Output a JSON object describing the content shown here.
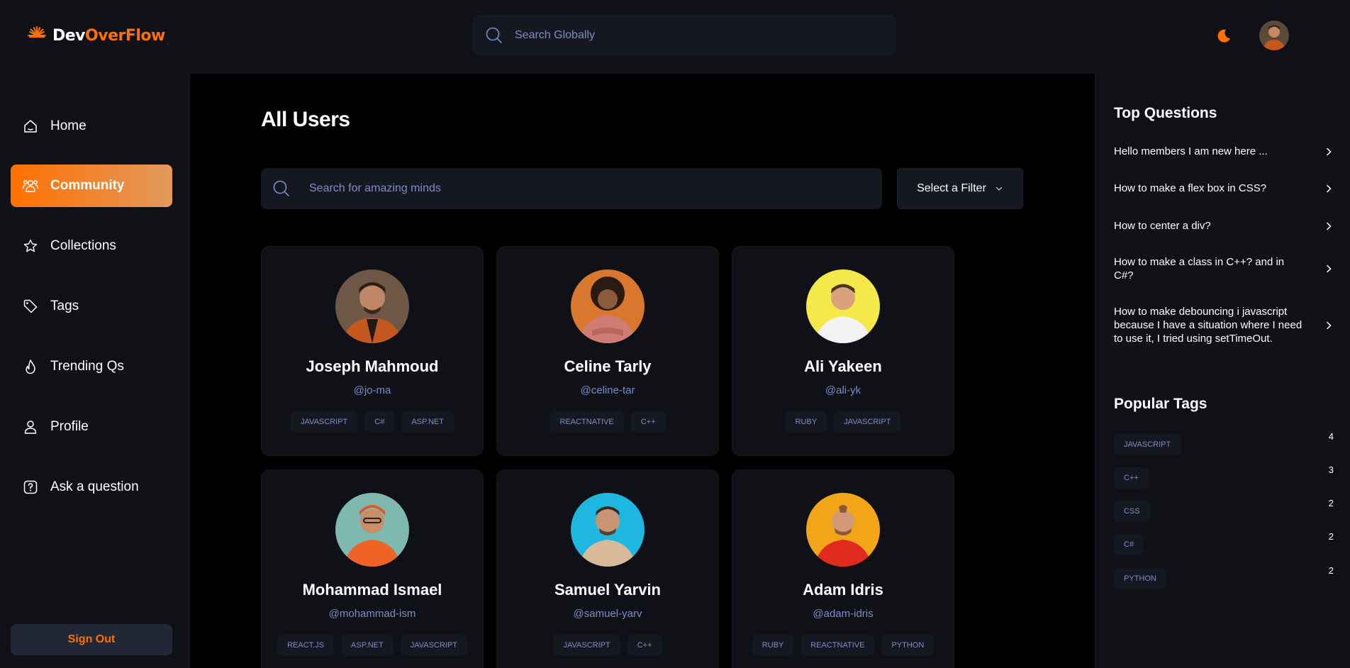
{
  "brand": {
    "name_part1": "Dev",
    "name_part2": "OverFlow"
  },
  "global_search": {
    "placeholder": "Search Globally"
  },
  "icons": {
    "logo": "starburst-logo-icon",
    "theme": "moon-icon",
    "search": "search-icon",
    "home": "home-icon",
    "community": "users-icon",
    "collections": "star-icon",
    "tags": "tag-icon",
    "trending": "flame-icon",
    "profile": "user-icon",
    "ask": "question-icon",
    "chevron_down": "chevron-down-icon",
    "chevron_right": "chevron-right-icon"
  },
  "colors": {
    "accent": "#ff7000",
    "accent_light": "#e2995f",
    "muted_text": "#7b8ec8",
    "panel": "#0f1117",
    "input": "#151821"
  },
  "sidebar": {
    "items": [
      {
        "label": "Home",
        "active": false
      },
      {
        "label": "Community",
        "active": true
      },
      {
        "label": "Collections",
        "active": false
      },
      {
        "label": "Tags",
        "active": false
      },
      {
        "label": "Trending Qs",
        "active": false
      },
      {
        "label": "Profile",
        "active": false
      },
      {
        "label": "Ask a question",
        "active": false
      }
    ],
    "signout_label": "Sign Out"
  },
  "main": {
    "title": "All Users",
    "search_placeholder": "Search for amazing minds",
    "filter_label": "Select a Filter",
    "users": [
      {
        "name": "Joseph Mahmoud",
        "username": "@jo-ma",
        "tags": [
          "JAVASCRIPT",
          "C#",
          "ASP.NET"
        ]
      },
      {
        "name": "Celine Tarly",
        "username": "@celine-tar",
        "tags": [
          "REACTNATIVE",
          "C++"
        ]
      },
      {
        "name": "Ali Yakeen",
        "username": "@ali-yk",
        "tags": [
          "RUBY",
          "JAVASCRIPT"
        ]
      },
      {
        "name": "Mohammad Ismael",
        "username": "@mohammad-ism",
        "tags": [
          "REACT.JS",
          "ASP.NET",
          "JAVASCRIPT"
        ]
      },
      {
        "name": "Samuel Yarvin",
        "username": "@samuel-yarv",
        "tags": [
          "JAVASCRIPT",
          "C++"
        ]
      },
      {
        "name": "Adam Idris",
        "username": "@adam-idris",
        "tags": [
          "RUBY",
          "REACTNATIVE",
          "PYTHON"
        ]
      }
    ]
  },
  "right_sidebar": {
    "top_questions_heading": "Top Questions",
    "questions": [
      "Hello members I am new here ...",
      "How to make a flex box in CSS?",
      "How to center a div?",
      "How to make a class in C++? and in C#?",
      "How to make debouncing i javascript because I have a situation where I need to use it, I tried using setTimeOut."
    ],
    "popular_tags_heading": "Popular Tags",
    "popular_tags": [
      {
        "name": "JAVASCRIPT",
        "count": "4"
      },
      {
        "name": "C++",
        "count": "3"
      },
      {
        "name": "CSS",
        "count": "2"
      },
      {
        "name": "C#",
        "count": "2"
      },
      {
        "name": "PYTHON",
        "count": "2"
      }
    ]
  }
}
